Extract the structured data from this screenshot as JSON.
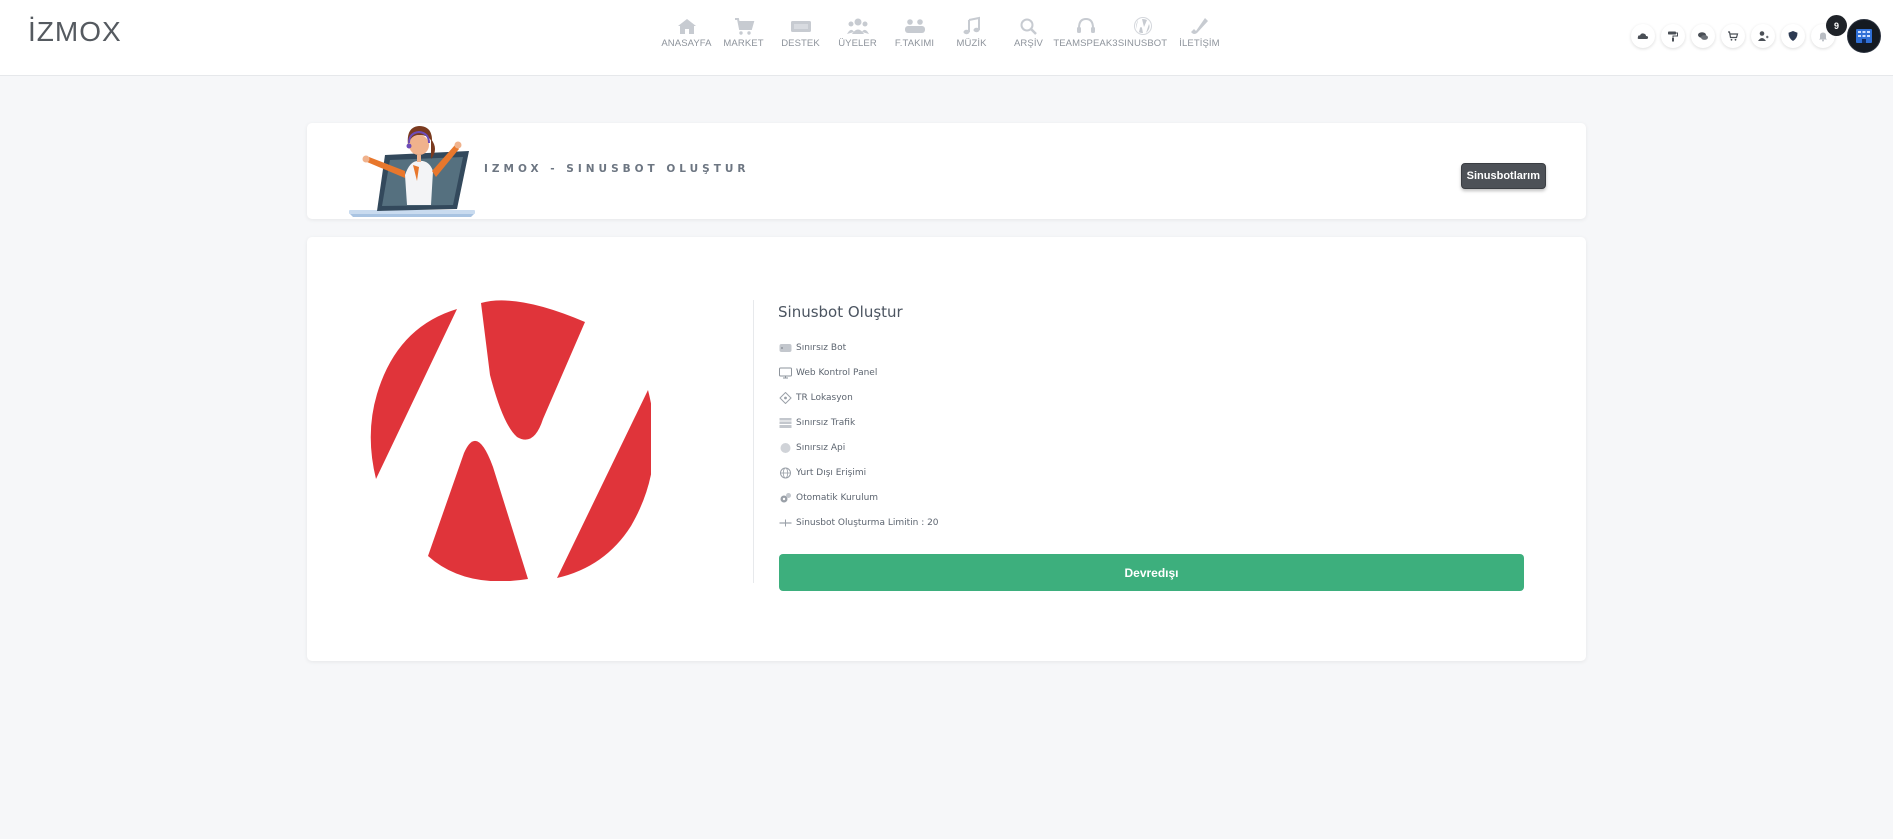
{
  "brand": {
    "logo_text": "İZMOX"
  },
  "nav": [
    {
      "label": "ANASAYFA",
      "icon": "home-icon"
    },
    {
      "label": "MARKET",
      "icon": "cart-icon"
    },
    {
      "label": "DESTEK",
      "icon": "ticket-icon"
    },
    {
      "label": "ÜYELER",
      "icon": "users-icon"
    },
    {
      "label": "F.TAKIMI",
      "icon": "team-icon"
    },
    {
      "label": "MÜZİK",
      "icon": "music-icon"
    },
    {
      "label": "ARŞİV",
      "icon": "search-icon"
    },
    {
      "label": "TEAMSPEAK3",
      "icon": "headset-icon"
    },
    {
      "label": "SINUSBOT",
      "icon": "sinusbot-icon"
    },
    {
      "label": "İLETİŞİM",
      "icon": "phone-icon"
    }
  ],
  "header_icons": [
    "cloud-icon",
    "paint-roller-icon",
    "chat-icon",
    "cart-icon",
    "user-icon",
    "shield-icon",
    "bell-icon"
  ],
  "notifications": {
    "count": "9"
  },
  "banner": {
    "title": "IZMOX - SINUSBOT OLUŞTUR",
    "button_label": "Sinusbotlarım"
  },
  "product": {
    "title": "Sinusbot Oluştur",
    "features": [
      {
        "icon": "server-icon",
        "text": "Sınırsız Bot"
      },
      {
        "icon": "monitor-icon",
        "text": "Web Kontrol Panel"
      },
      {
        "icon": "location-icon",
        "text": "TR Lokasyon"
      },
      {
        "icon": "traffic-icon",
        "text": "Sınırsız Trafik"
      },
      {
        "icon": "api-icon",
        "text": "Sınırsız Api"
      },
      {
        "icon": "globe-icon",
        "text": "Yurt Dışı Erişimi"
      },
      {
        "icon": "gear-icon",
        "text": "Otomatik Kurulum"
      },
      {
        "icon": "limit-icon",
        "text": "Sinusbot Oluşturma Limitin : 20"
      }
    ],
    "action_label": "Devredışı"
  },
  "colors": {
    "background": "#f6f7f9",
    "brand_red": "#e0343a",
    "action_green": "#3daf7d",
    "dark_button": "#4d5157"
  }
}
